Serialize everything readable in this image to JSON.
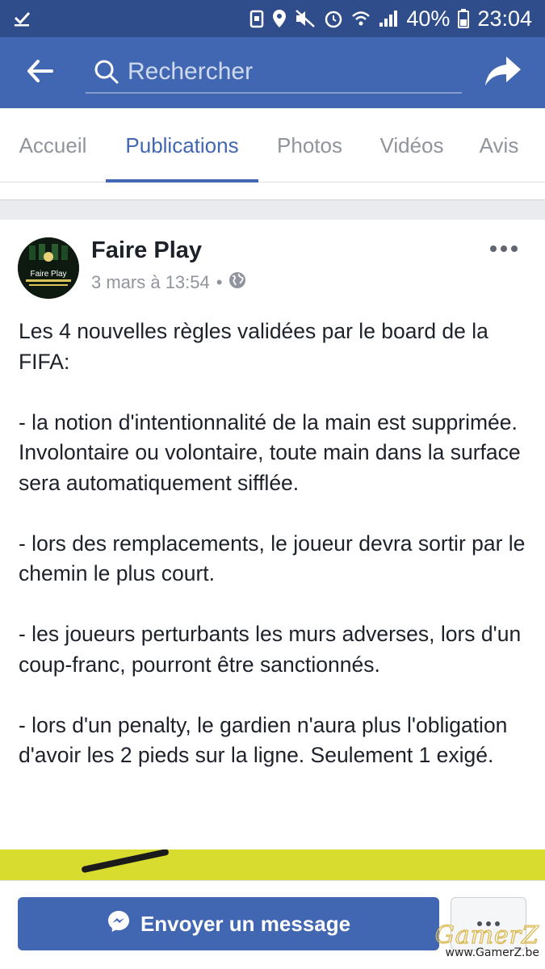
{
  "status_bar": {
    "battery": "40%",
    "time": "23:04",
    "icons": [
      "check-icon",
      "secure-icon",
      "location-icon",
      "mute-icon",
      "alarm-icon",
      "wifi-icon",
      "signal-icon",
      "battery-icon"
    ]
  },
  "header": {
    "back_icon": "arrow-left-icon",
    "search_placeholder": "Rechercher",
    "share_icon": "share-icon"
  },
  "tabs": [
    {
      "label": "Accueil",
      "active": false
    },
    {
      "label": "Publications",
      "active": true
    },
    {
      "label": "Photos",
      "active": false
    },
    {
      "label": "Vidéos",
      "active": false
    },
    {
      "label": "Avis",
      "active": false
    }
  ],
  "post": {
    "page_name": "Faire Play",
    "timestamp": "3 mars à 13:54",
    "separator": "•",
    "audience_icon": "globe-icon",
    "avatar_text": "Faire Play",
    "paragraphs": [
      "Les 4 nouvelles règles validées par le board de la FIFA:",
      "- la notion d'intentionnalité de la main est supprimée. Involontaire ou volontaire, toute main dans la surface sera automatiquement sifflée.",
      "- lors des remplacements, le joueur devra sortir par le chemin le plus court.",
      "- les joueurs perturbants les murs adverses, lors d'un coup-franc, pourront être sanctionnés.",
      "- lors d'un penalty, le gardien n'aura plus l'obligation d'avoir les 2 pieds sur la ligne. Seulement 1 exigé."
    ]
  },
  "bottom_bar": {
    "message_button": "Envoyer un message",
    "messenger_icon": "messenger-icon",
    "more_button": "more-icon"
  },
  "watermark": {
    "logo": "GamerZ",
    "url": "www.GamerZ.be"
  },
  "colors": {
    "brand": "#4267b2",
    "status_bar": "#2f4d8a",
    "text": "#1d2129",
    "muted": "#90949c"
  }
}
